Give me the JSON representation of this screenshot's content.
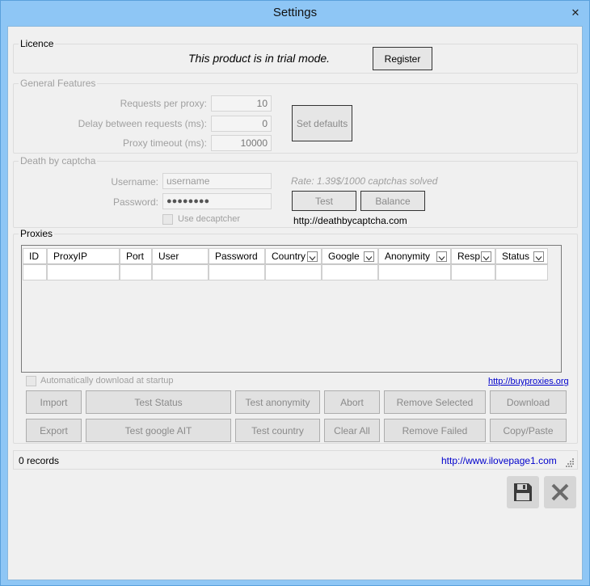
{
  "window": {
    "title": "Settings",
    "close_glyph": "✕"
  },
  "licence": {
    "legend": "Licence",
    "message": "This product is in trial mode.",
    "register_label": "Register"
  },
  "general": {
    "legend": "General Features",
    "requests_label": "Requests per proxy:",
    "requests_value": "10",
    "delay_label": "Delay between requests (ms):",
    "delay_value": "0",
    "timeout_label": "Proxy timeout (ms):",
    "timeout_value": "10000",
    "set_defaults_label": "Set defaults"
  },
  "captcha": {
    "legend": "Death by captcha",
    "username_label": "Username:",
    "username_value": "username",
    "password_label": "Password:",
    "password_value": "●●●●●●●●",
    "rate_text": "Rate: 1.39$/1000 captchas solved",
    "test_label": "Test",
    "balance_label": "Balance",
    "use_decaptcher_label": "Use decaptcher",
    "site_url": "http://deathbycaptcha.com"
  },
  "proxies": {
    "legend": "Proxies",
    "columns": [
      "ID",
      "ProxyIP",
      "Port",
      "User",
      "Password",
      "Country",
      "Google",
      "Anonymity",
      "Resp.",
      "Status"
    ],
    "auto_download_label": "Automatically download at startup",
    "buy_link": "http://buyproxies.org",
    "buttons_row1": [
      "Import",
      "Test Status",
      "Test anonymity",
      "Abort",
      "Remove Selected",
      "Download"
    ],
    "buttons_row2": [
      "Export",
      "Test google AIT",
      "Test country",
      "Clear All",
      "Remove Failed",
      "Copy/Paste"
    ]
  },
  "statusbar": {
    "records": "0 records",
    "site_link": "http://www.ilovepage1.com"
  },
  "icons": {
    "save": "floppy-disk-icon",
    "cancel": "cancel-x-icon"
  },
  "colors": {
    "title_bar": "#8ec6f5",
    "link": "#0000cc"
  }
}
